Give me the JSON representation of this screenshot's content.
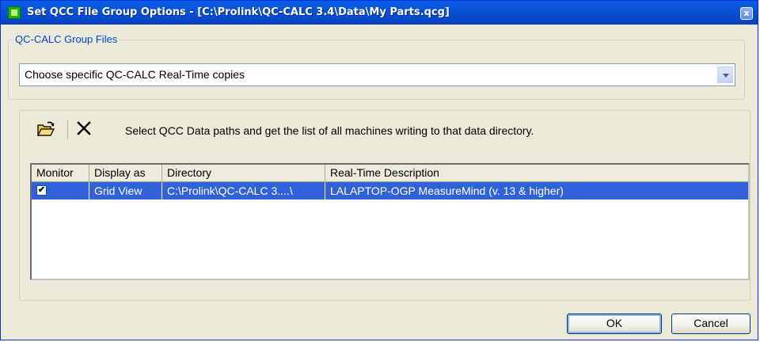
{
  "window": {
    "title": "Set QCC File Group Options - [C:\\Prolink\\QC-CALC 3.4\\Data\\My Parts.qcg]",
    "close_label": "x"
  },
  "group": {
    "legend": "QC-CALC Group Files",
    "selection": "Choose specific QC-CALC Real-Time copies"
  },
  "toolbar": {
    "open_icon": "folder-open-icon",
    "delete_icon": "delete-x-icon",
    "delete_glyph": "✕",
    "instruction": "Select QCC Data paths and get the list of all machines writing to that data directory."
  },
  "table": {
    "headers": [
      "Monitor",
      "Display as",
      "Directory",
      "Real-Time Description"
    ],
    "rows": [
      {
        "monitor_checked": true,
        "check_glyph": "✔",
        "display_as": "Grid View",
        "directory": "C:\\Prolink\\QC-CALC 3....\\",
        "description": "LALAPTOP-OGP MeasureMind (v. 13 & higher)"
      }
    ]
  },
  "buttons": {
    "ok": "OK",
    "cancel": "Cancel"
  },
  "colors": {
    "title_bar": "#0853d6",
    "selection": "#3162d9",
    "dialog_bg": "#ece9d8",
    "legend_text": "#0046d5"
  }
}
